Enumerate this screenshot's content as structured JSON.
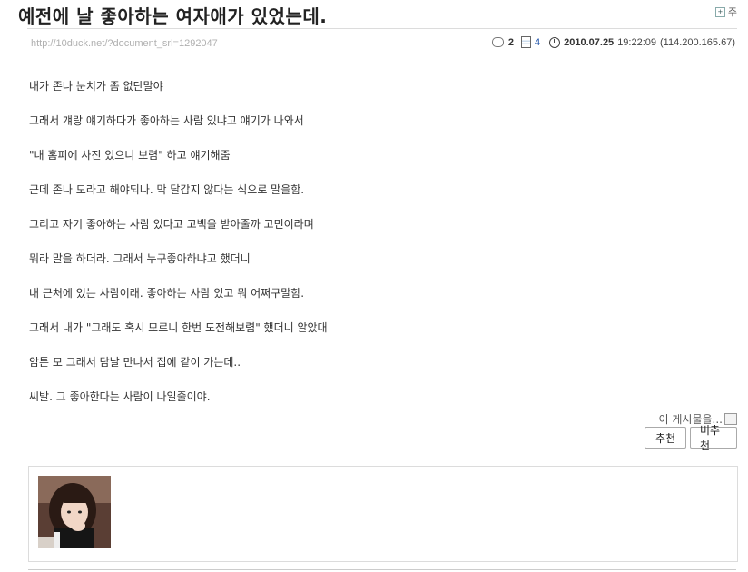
{
  "post": {
    "title": "예전에 날 좋아하는 여자애가 있었는데.",
    "title_ext": "주",
    "url": "http://10duck.net/?document_srl=1292047",
    "comment_count": "2",
    "view_count": "4",
    "date": "2010.07.25",
    "time": "19:22:09",
    "ip": "(114.200.165.67)",
    "lines": [
      "내가 존나 눈치가 좀 없단말야",
      "그래서 걔랑 얘기하다가 좋아하는 사람 있냐고 얘기가 나와서",
      "\"내 홈피에 사진 있으니 보렴\" 하고 얘기해줌",
      "근데 존나 모라고 해야되나. 막 달갑지 않다는 식으로 말을함.",
      "그리고 자기 좋아하는 사람 있다고 고백을 받아줄까 고민이라며",
      "뭐라 말을 하더라. 그래서 누구좋아하냐고 했더니",
      "내 근처에 있는 사람이래. 좋아하는 사람 있고 뭐 어쩌구말함.",
      "그래서 내가 \"그래도 혹시 모르니 한번 도전해보렴\" 했더니 알았대",
      "암튼 모 그래서 담날 만나서 집에 같이 가는데..",
      "씨발. 그 좋아한다는 사람이 나일줄이야."
    ]
  },
  "actions": {
    "report_label": "이 게시물을...",
    "recommend_label": "추천",
    "notrecommend_label": "비추천"
  },
  "icons": {
    "comment": "comment-icon",
    "views": "document-icon",
    "date": "clock-icon",
    "report": "report-icon"
  }
}
